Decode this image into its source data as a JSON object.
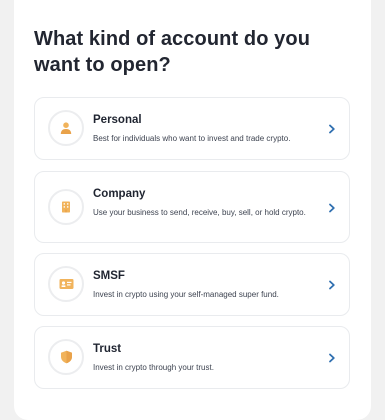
{
  "heading": "What kind of account do you want to open?",
  "accent_color": "#f1b35b",
  "chevron_color": "#2f6fb0",
  "options": [
    {
      "title": "Personal",
      "description": "Best for individuals who want to invest and trade crypto.",
      "icon": "person-icon"
    },
    {
      "title": "Company",
      "description": "Use your business to send, receive, buy, sell, or hold crypto.",
      "icon": "building-icon"
    },
    {
      "title": "SMSF",
      "description": "Invest in crypto using your self-managed super fund.",
      "icon": "id-card-icon"
    },
    {
      "title": "Trust",
      "description": "Invest in crypto through your trust.",
      "icon": "shield-icon"
    }
  ]
}
